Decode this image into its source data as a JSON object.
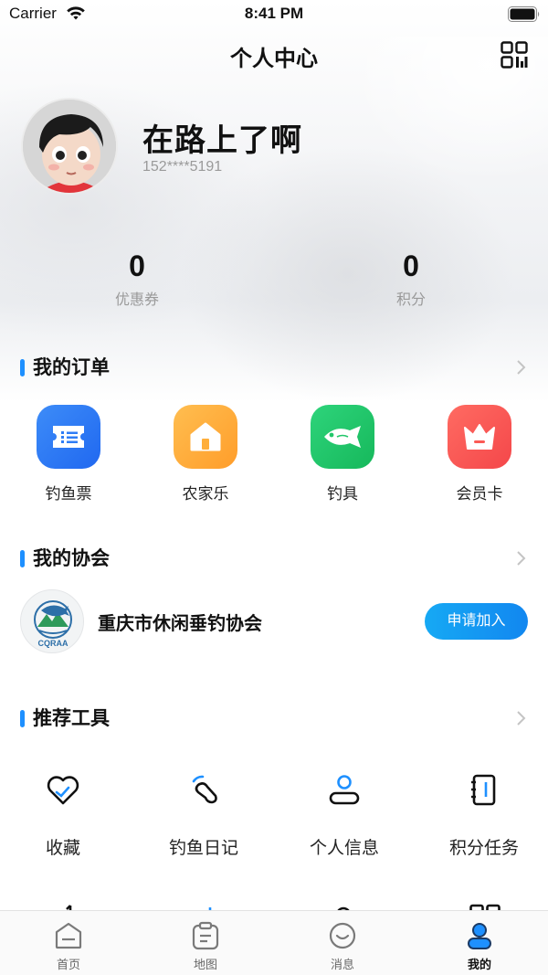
{
  "status_bar": {
    "carrier": "Carrier",
    "time": "8:41 PM"
  },
  "header": {
    "title": "个人中心",
    "qr_icon": "qr-code-icon"
  },
  "profile": {
    "nickname": "在路上了啊",
    "phone": "152****5191"
  },
  "stats": [
    {
      "value": "0",
      "label": "优惠券"
    },
    {
      "value": "0",
      "label": "积分"
    }
  ],
  "orders": {
    "title": "我的订单",
    "items": [
      {
        "label": "钓鱼票",
        "icon": "ticket-icon",
        "color": "#2f7df6"
      },
      {
        "label": "农家乐",
        "icon": "house-icon",
        "color": "#ffae3a"
      },
      {
        "label": "钓具",
        "icon": "fish-icon",
        "color": "#22c76a"
      },
      {
        "label": "会员卡",
        "icon": "crown-icon",
        "color": "#fb5a55"
      }
    ]
  },
  "association": {
    "title": "我的协会",
    "name": "重庆市休闲垂钓协会",
    "logo_text": "CQRAA",
    "join_label": "申请加入"
  },
  "tools": {
    "title": "推荐工具",
    "items": [
      {
        "label": "收藏",
        "icon": "heart-icon"
      },
      {
        "label": "钓鱼日记",
        "icon": "diary-icon"
      },
      {
        "label": "个人信息",
        "icon": "user-icon"
      },
      {
        "label": "积分任务",
        "icon": "notebook-icon"
      }
    ]
  },
  "tab_bar": {
    "active": "我的",
    "items": [
      {
        "label": "首页",
        "icon": "home-icon"
      },
      {
        "label": "地图",
        "icon": "map-icon"
      },
      {
        "label": "消息",
        "icon": "message-icon"
      },
      {
        "label": "我的",
        "icon": "profile-icon"
      }
    ]
  },
  "colors": {
    "accent": "#1e90ff",
    "join_button": "#1287f0"
  }
}
